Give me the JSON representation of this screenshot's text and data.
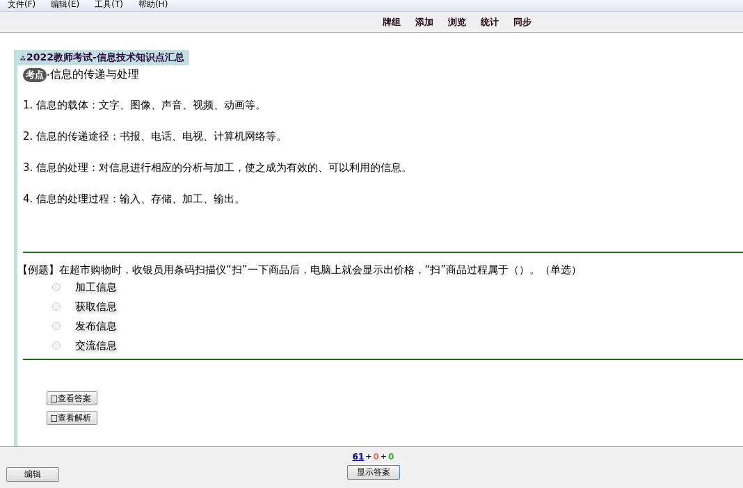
{
  "menu": [
    "文件(F)",
    "编辑(E)",
    "工具(T)",
    "帮助(H)"
  ],
  "toolbar": [
    "牌组",
    "添加",
    "浏览",
    "统计",
    "同步"
  ],
  "card": {
    "deck_title": "2022教师考试-信息技术知识点汇总",
    "tag": "考点",
    "topic": "信息的传递与处理",
    "points": [
      "1. 信息的载体：文字、图像、声音、视频、动画等。",
      "2. 信息的传递途径：书报、电话、电视、计算机网络等。",
      "3. 信息的处理：对信息进行相应的分析与加工，使之成为有效的、可以利用的信息。",
      "4. 信息的处理过程：输入、存储、加工、输出。"
    ],
    "question": "【例题】在超市购物时，收银员用条码扫描仪“扫”一下商品后，电脑上就会显示出价格，“扫”商品过程属于（）。（单选）",
    "options": [
      {
        "label": "加工信息",
        "selected": false
      },
      {
        "label": "获取信息",
        "selected": false
      },
      {
        "label": "发布信息",
        "selected": false
      },
      {
        "label": "交流信息",
        "selected": false
      }
    ],
    "buttons": [
      "□查看答案",
      "□查看解析"
    ]
  },
  "bottom": {
    "edit_button": "编辑",
    "counts": [
      {
        "text": "61",
        "color": "#0000aa"
      },
      {
        "text": "0",
        "color": "#e07050"
      },
      {
        "text": "0",
        "color": "#30b030"
      }
    ],
    "separator": "+",
    "answer_button": "显示答案"
  }
}
